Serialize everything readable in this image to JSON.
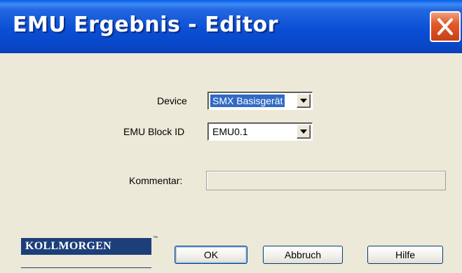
{
  "window": {
    "title": "EMU Ergebnis - Editor"
  },
  "form": {
    "device_label": "Device",
    "device_value": "SMX Basisgerät",
    "block_id_label": "EMU Block ID",
    "block_id_value": "EMU0.1",
    "comment_label": "Kommentar:",
    "comment_value": ""
  },
  "logo": {
    "text": "KOLLMORGEN",
    "trademark": "™"
  },
  "buttons": {
    "ok": "OK",
    "cancel": "Abbruch",
    "help": "Hilfe"
  },
  "colors": {
    "titlebar": "#0a4fd6",
    "dialog_background": "#ece9d8",
    "selection": "#316ac5",
    "close_button": "#e25a2a",
    "logo_background": "#1c3f7a"
  }
}
